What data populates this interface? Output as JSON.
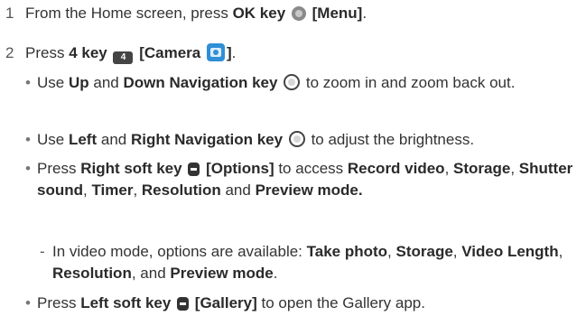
{
  "steps": [
    {
      "number": "1",
      "text_before": "From the Home screen, press ",
      "key_label": "OK key",
      "icon": "ok-key-icon",
      "bracket_label": "[Menu]",
      "text_after": "."
    },
    {
      "number": "2",
      "text_before": "Press ",
      "key_label": "4 key",
      "icon": "four-key-icon",
      "icon_text": "4",
      "bracket_label": "[Camera",
      "bracket_close": "]",
      "text_after": "."
    }
  ],
  "bullets": [
    {
      "pre": "Use ",
      "b1": "Up",
      "mid": " and ",
      "b2": "Down Navigation key",
      "post": " to zoom in and zoom back out."
    },
    {
      "pre": "Use ",
      "b1": "Left",
      "mid": " and ",
      "b2": "Right Navigation key",
      "post": " to adjust the brightness."
    },
    {
      "pre": "Press ",
      "b1": "Right soft key",
      "b1b": "[Options]",
      "mid": " to access ",
      "items": [
        "Record video",
        "Storage",
        "Shutter sound",
        "Timer",
        "Resolution",
        "Preview mode."
      ],
      "sep": ", ",
      "and": " and "
    },
    {
      "pre": "Press ",
      "b1": "Left soft key",
      "b1b": "[Gallery]",
      "post": " to open the Gallery app."
    }
  ],
  "sub_item": {
    "dash": "-",
    "pre": "In video mode, options are available: ",
    "items": [
      "Take photo",
      "Storage",
      "Video Length",
      "Resolution",
      "Preview mode"
    ],
    "sep": ", ",
    "and": ", and ",
    "post": "."
  },
  "bullet_char": "•"
}
